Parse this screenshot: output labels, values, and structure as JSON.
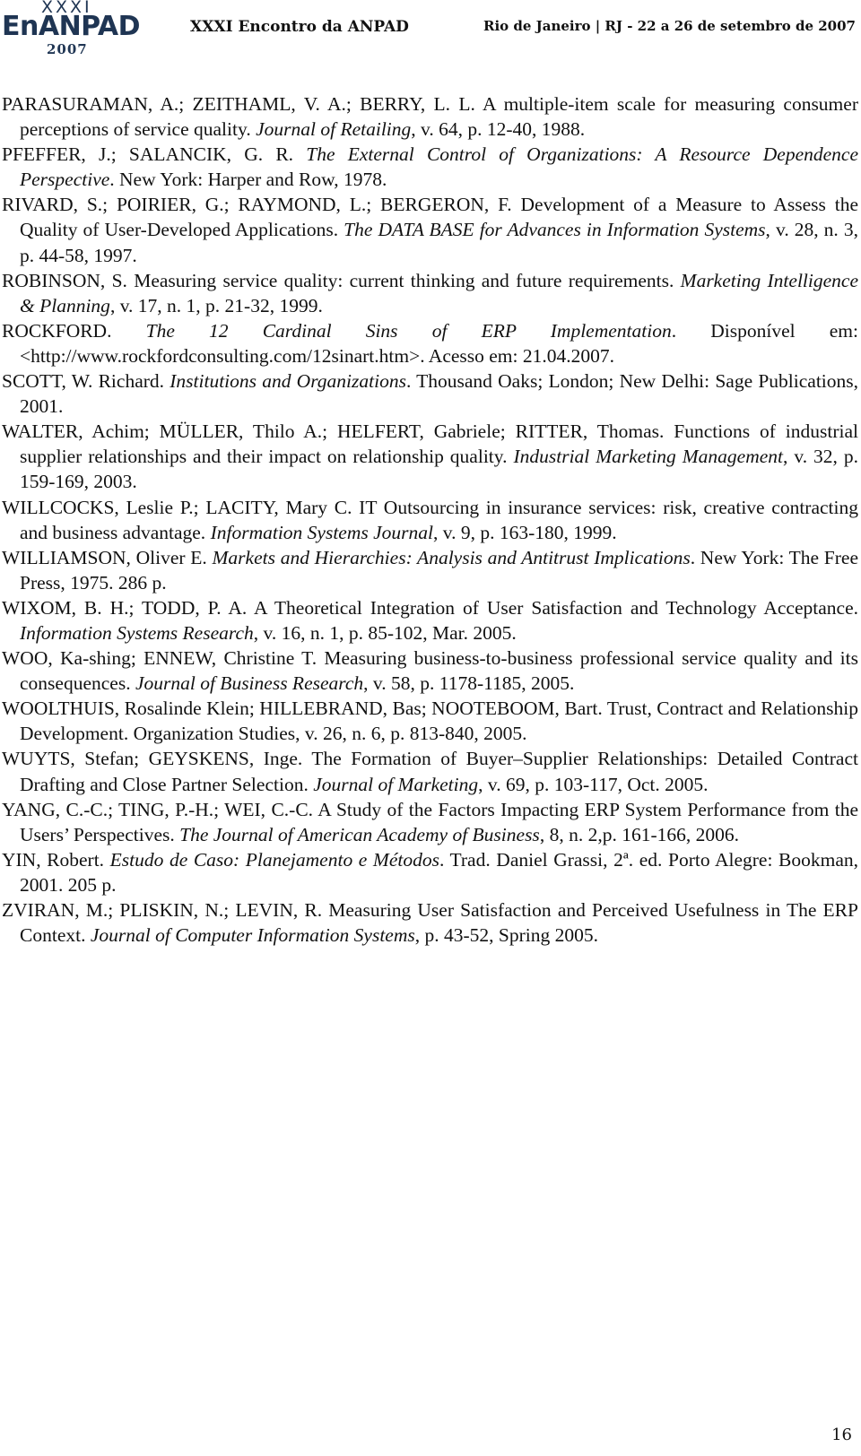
{
  "header": {
    "logo": {
      "top": "XXXI",
      "main": "EnANPAD",
      "year": "2007"
    },
    "event_title": "XXXI Encontro da ANPAD",
    "event_location": "Rio de Janeiro | RJ - 22 a 26 de setembro de 2007"
  },
  "references": [
    {
      "pre": "PARASURAMAN, A.; ZEITHAML, V. A.; BERRY, L. L. A multiple-item scale for measuring consumer perceptions of service quality. ",
      "italic": "Journal of Retailing",
      "post": ", v. 64, p. 12-40, 1988."
    },
    {
      "pre": "PFEFFER, J.; SALANCIK, G. R. ",
      "italic": "The External Control of Organizations: A Resource Dependence Perspective",
      "post": ". New York: Harper and Row, 1978."
    },
    {
      "pre": "RIVARD, S.; POIRIER, G.; RAYMOND, L.;  BERGERON, F. Development of a Measure to Assess the Quality of User-Developed Applications. ",
      "italic": "The DATA BASE for Advances in Information Systems",
      "post": ", v. 28, n. 3, p. 44-58, 1997."
    },
    {
      "pre": "ROBINSON, S. Measuring service quality: current thinking and future requirements. ",
      "italic": "Marketing Intelligence & Planning",
      "post": ", v. 17, n. 1, p. 21-32, 1999."
    },
    {
      "pre": "ROCKFORD. ",
      "italic": "The 12 Cardinal Sins of ERP Implementation",
      "post": ". Disponível em: <http://www.rockfordconsulting.com/12sinart.htm>. Acesso em: 21.04.2007."
    },
    {
      "pre": "SCOTT, W. Richard. ",
      "italic": "Institutions and Organizations",
      "post": ". Thousand Oaks; London; New Delhi: Sage Publications, 2001."
    },
    {
      "pre": "WALTER, Achim; MÜLLER, Thilo A.; HELFERT, Gabriele; RITTER, Thomas. Functions of industrial supplier relationships and their impact on relationship quality. ",
      "italic": "Industrial Marketing Management",
      "post": ", v. 32, p. 159-169, 2003."
    },
    {
      "pre": "WILLCOCKS, Leslie P.; LACITY, Mary C. IT Outsourcing in insurance services: risk, creative contracting and business advantage. ",
      "italic": "Information Systems Journal",
      "post": ", v. 9, p. 163-180, 1999."
    },
    {
      "pre": "WILLIAMSON, Oliver E. ",
      "italic": "Markets and Hierarchies: Analysis and Antitrust Implications",
      "post": ". New York: The Free Press, 1975. 286 p."
    },
    {
      "pre": "WIXOM, B. H.;  TODD, P. A. A Theoretical Integration of User Satisfaction and Technology Acceptance. ",
      "italic": "Information Systems Research",
      "post": ", v. 16, n. 1, p. 85-102, Mar. 2005."
    },
    {
      "pre": "WOO, Ka-shing; ENNEW, Christine T. Measuring business-to-business professional service quality and its consequences. ",
      "italic": "Journal of Business Research",
      "post": ", v. 58, p. 1178-1185, 2005."
    },
    {
      "pre": "WOOLTHUIS, Rosalinde Klein; HILLEBRAND, Bas; NOOTEBOOM, Bart. Trust, Contract and Relationship Development. Organization Studies, v. 26, n. 6, p. 813-840, 2005.",
      "italic": "",
      "post": ""
    },
    {
      "pre": "WUYTS, Stefan; GEYSKENS, Inge. The Formation of Buyer–Supplier Relationships: Detailed  Contract Drafting and Close Partner Selection. ",
      "italic": "Journal of Marketing",
      "post": ", v. 69, p. 103-117, Oct. 2005."
    },
    {
      "pre": "YANG, C.-C.; TING, P.-H.; WEI, C.-C. A Study of the Factors Impacting ERP System Performance from the Users’ Perspectives. ",
      "italic": "The Journal of American Academy of Business",
      "post": ", 8, n. 2,p. 161-166, 2006."
    },
    {
      "pre": "YIN, Robert. ",
      "italic": "Estudo de Caso: Planejamento e Métodos",
      "post": ". Trad. Daniel Grassi, 2ª. ed. Porto Alegre: Bookman, 2001. 205 p."
    },
    {
      "pre": "ZVIRAN, M.; PLISKIN, N.; LEVIN, R. Measuring User Satisfaction and Perceived Usefulness in The ERP Context. ",
      "italic": "Journal of Computer Information Systems",
      "post": ", p. 43-52, Spring 2005."
    }
  ],
  "page_number": "16"
}
